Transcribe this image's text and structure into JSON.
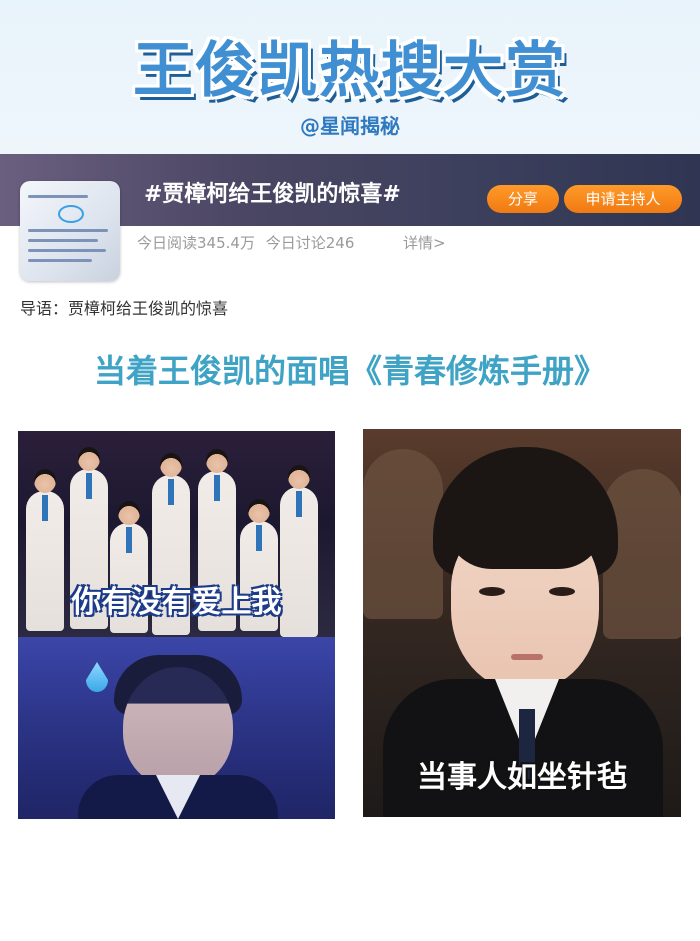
{
  "header": {
    "title": "王俊凯热搜大赏",
    "subtitle": "@星闻揭秘"
  },
  "topic": {
    "title": "#贾樟柯给王俊凯的惊喜#",
    "share_label": "分享",
    "host_label": "申请主持人",
    "reads": "今日阅读345.4万",
    "discussions": "今日讨论246",
    "details_label": "详情>"
  },
  "intro": "导语：贾樟柯给王俊凯的惊喜",
  "section_heading": "当着王俊凯的面唱《青春修炼手册》",
  "gifs": [
    {
      "caption": "你有没有爱上我"
    },
    {
      "caption": "当事人如坐针毡"
    }
  ],
  "colors": {
    "title_blue": "#3f8fd2",
    "heading_teal": "#3ea3c4",
    "button_orange": "#f58a1c"
  }
}
